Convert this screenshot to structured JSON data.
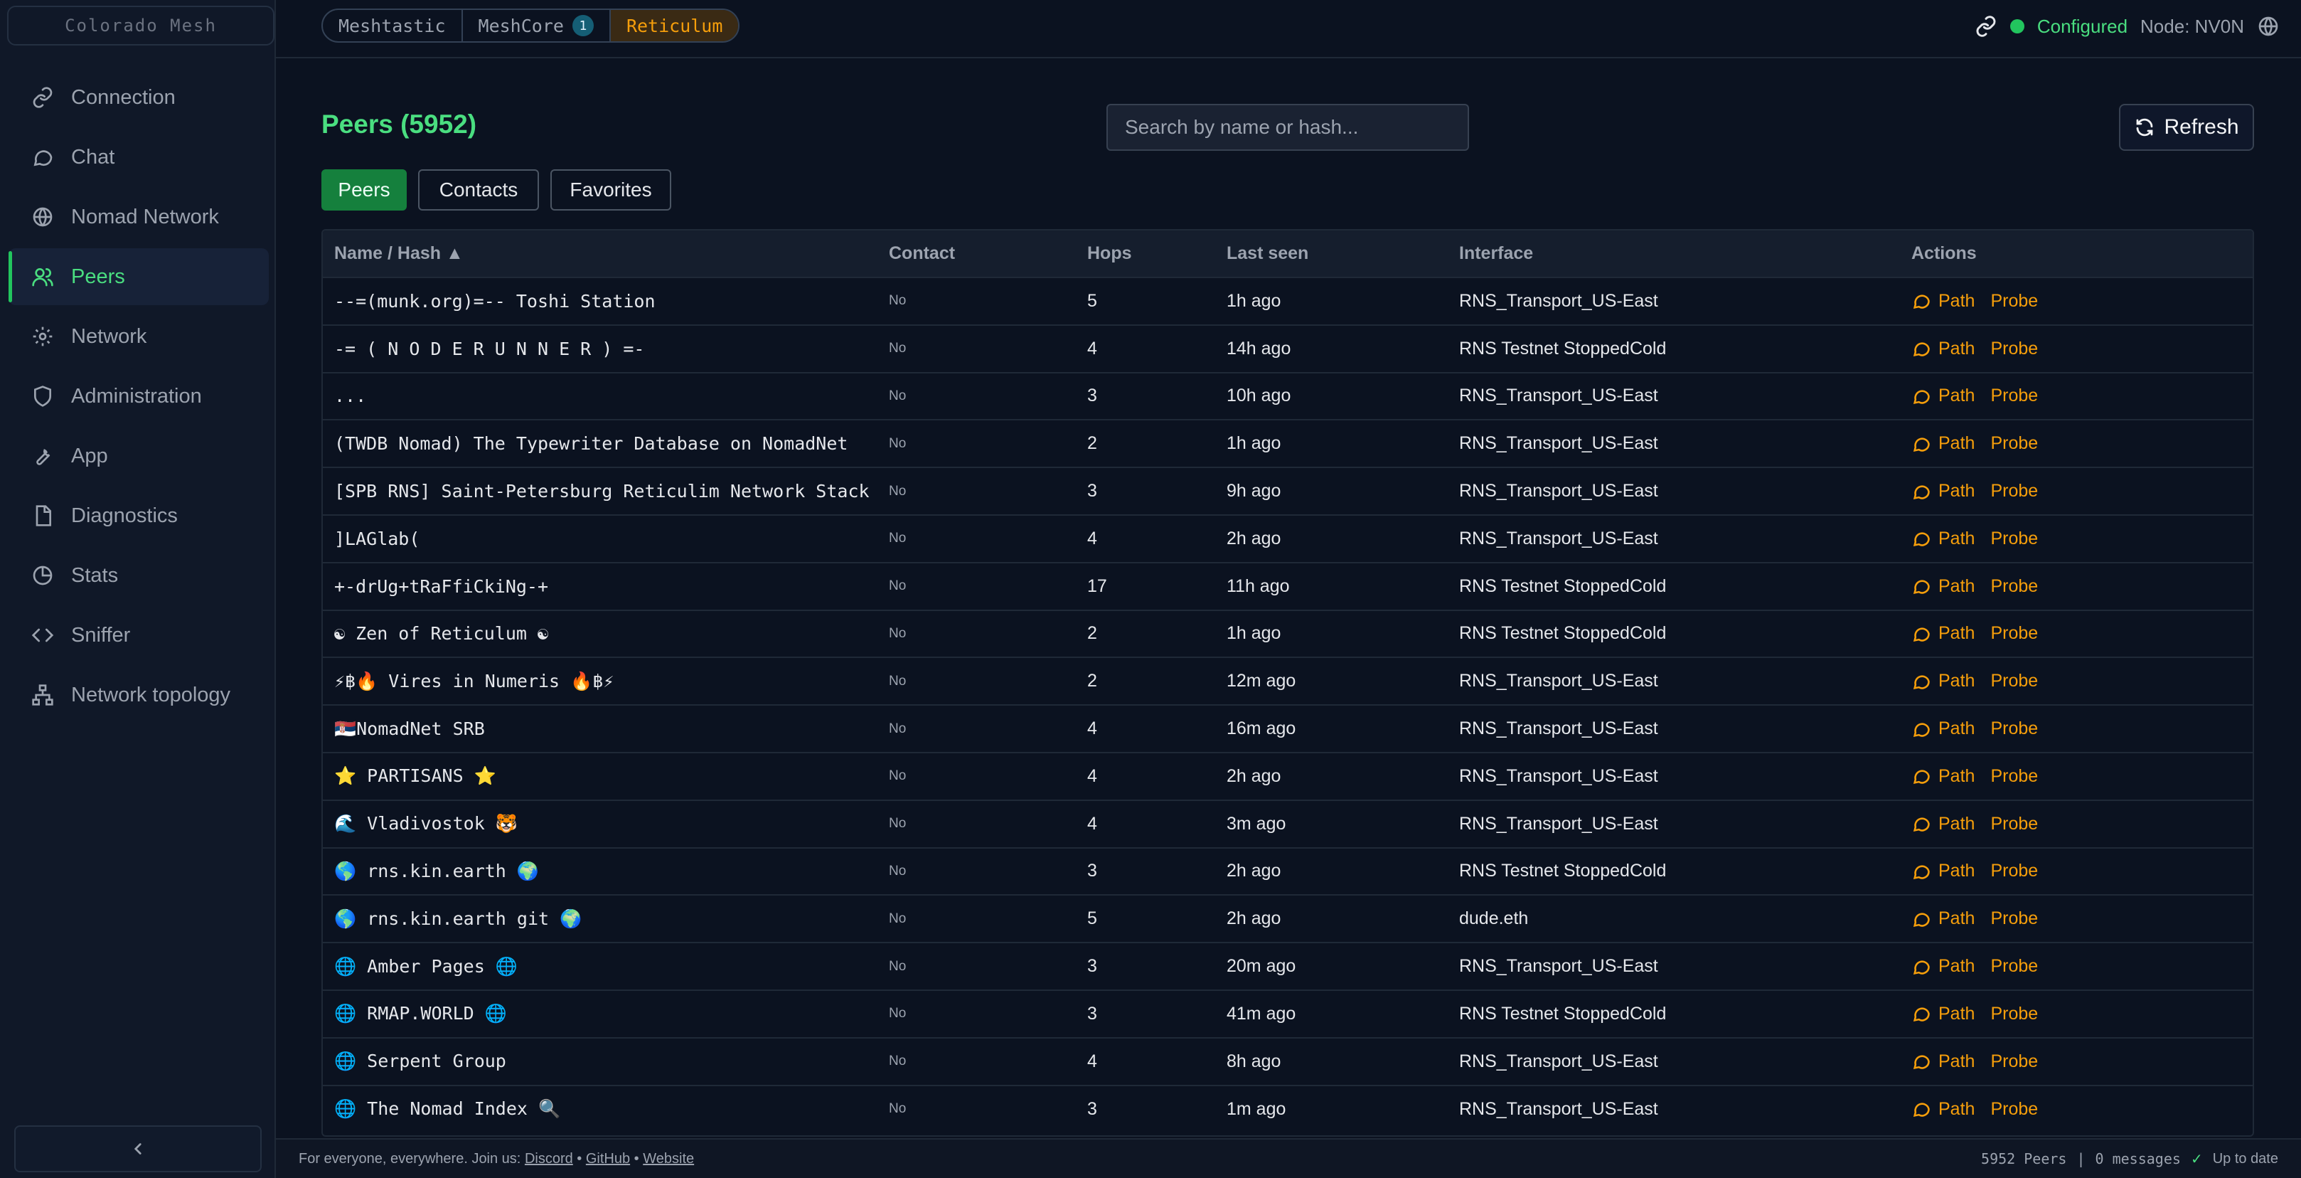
{
  "sidebar": {
    "brand": "Colorado Mesh",
    "items": [
      {
        "label": "Connection",
        "icon": "link-icon"
      },
      {
        "label": "Chat",
        "icon": "chat-icon"
      },
      {
        "label": "Nomad Network",
        "icon": "globe-icon"
      },
      {
        "label": "Peers",
        "icon": "users-icon",
        "active": true
      },
      {
        "label": "Network",
        "icon": "gear-icon"
      },
      {
        "label": "Administration",
        "icon": "shield-icon"
      },
      {
        "label": "App",
        "icon": "wrench-icon"
      },
      {
        "label": "Diagnostics",
        "icon": "document-icon"
      },
      {
        "label": "Stats",
        "icon": "pie-chart-icon"
      },
      {
        "label": "Sniffer",
        "icon": "code-icon"
      },
      {
        "label": "Network topology",
        "icon": "topology-icon"
      }
    ],
    "collapse_icon": "chevron-left-icon"
  },
  "topbar": {
    "protocols": [
      {
        "label": "Meshtastic"
      },
      {
        "label": "MeshCore",
        "badge": "1"
      },
      {
        "label": "Reticulum",
        "active": true
      }
    ],
    "status_label": "Configured",
    "status_color": "#22c55e",
    "node_label": "Node: NV0N"
  },
  "main": {
    "title": "Peers (5952)",
    "search_placeholder": "Search by name or hash...",
    "refresh_label": "Refresh",
    "filters": [
      "Peers",
      "Contacts",
      "Favorites"
    ],
    "columns": [
      "Name / Hash ▲",
      "Contact",
      "Hops",
      "Last seen",
      "Interface",
      "Actions"
    ],
    "action_labels": {
      "path": "Path",
      "probe": "Probe"
    },
    "rows": [
      {
        "name": "--=(munk.org)=-- Toshi Station",
        "contact": "No",
        "hops": "5",
        "last_seen": "1h ago",
        "interface": "RNS_Transport_US-East"
      },
      {
        "name": "-= ( N O D E R U N N E R ) =-",
        "contact": "No",
        "hops": "4",
        "last_seen": "14h ago",
        "interface": "RNS Testnet StoppedCold"
      },
      {
        "name": "...",
        "contact": "No",
        "hops": "3",
        "last_seen": "10h ago",
        "interface": "RNS_Transport_US-East"
      },
      {
        "name": "(TWDB Nomad) The Typewriter Database on NomadNet",
        "contact": "No",
        "hops": "2",
        "last_seen": "1h ago",
        "interface": "RNS_Transport_US-East"
      },
      {
        "name": "[SPB RNS] Saint-Petersburg Reticulim Network Stack",
        "contact": "No",
        "hops": "3",
        "last_seen": "9h ago",
        "interface": "RNS_Transport_US-East"
      },
      {
        "name": "]LAGlab(",
        "contact": "No",
        "hops": "4",
        "last_seen": "2h ago",
        "interface": "RNS_Transport_US-East"
      },
      {
        "name": "+-drUg+tRaFfiCkiNg-+",
        "contact": "No",
        "hops": "17",
        "last_seen": "11h ago",
        "interface": "RNS Testnet StoppedCold"
      },
      {
        "name": "☯ Zen of Reticulum ☯",
        "contact": "No",
        "hops": "2",
        "last_seen": "1h ago",
        "interface": "RNS Testnet StoppedCold"
      },
      {
        "name": "⚡฿🔥 Vires in Numeris 🔥฿⚡",
        "contact": "No",
        "hops": "2",
        "last_seen": "12m ago",
        "interface": "RNS_Transport_US-East"
      },
      {
        "name": "🇷🇸NomadNet SRB",
        "contact": "No",
        "hops": "4",
        "last_seen": "16m ago",
        "interface": "RNS_Transport_US-East"
      },
      {
        "name": "⭐ PARTISANS ⭐",
        "contact": "No",
        "hops": "4",
        "last_seen": "2h ago",
        "interface": "RNS_Transport_US-East"
      },
      {
        "name": "🌊 Vladivostok 🐯",
        "contact": "No",
        "hops": "4",
        "last_seen": "3m ago",
        "interface": "RNS_Transport_US-East"
      },
      {
        "name": "🌎 rns.kin.earth 🌍",
        "contact": "No",
        "hops": "3",
        "last_seen": "2h ago",
        "interface": "RNS Testnet StoppedCold"
      },
      {
        "name": "🌎 rns.kin.earth git 🌍",
        "contact": "No",
        "hops": "5",
        "last_seen": "2h ago",
        "interface": "dude.eth"
      },
      {
        "name": "🌐 Amber Pages 🌐",
        "contact": "No",
        "hops": "3",
        "last_seen": "20m ago",
        "interface": "RNS_Transport_US-East"
      },
      {
        "name": "🌐 RMAP.WORLD 🌐",
        "contact": "No",
        "hops": "3",
        "last_seen": "41m ago",
        "interface": "RNS Testnet StoppedCold"
      },
      {
        "name": "🌐 Serpent Group",
        "contact": "No",
        "hops": "4",
        "last_seen": "8h ago",
        "interface": "RNS_Transport_US-East"
      },
      {
        "name": "🌐 The Nomad Index 🔍",
        "contact": "No",
        "hops": "3",
        "last_seen": "1m ago",
        "interface": "RNS_Transport_US-East"
      }
    ]
  },
  "footer": {
    "tagline": "For everyone, everywhere. Join us:",
    "links": [
      "Discord",
      "GitHub",
      "Website"
    ],
    "peers_count": "5952 Peers",
    "messages": "0 messages",
    "update_status": "Up to date"
  },
  "colors": {
    "accent": "#4ade80",
    "action": "#f59e0b",
    "reticulum_active": "#f59e0b"
  }
}
